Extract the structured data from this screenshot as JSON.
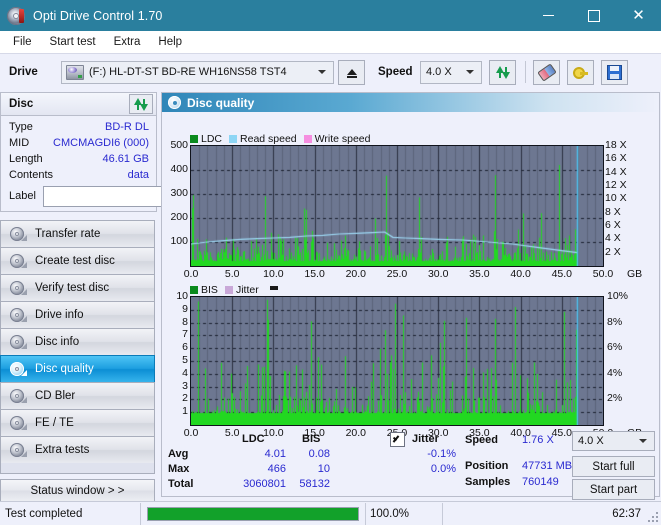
{
  "window": {
    "title": "Opti Drive Control 1.70",
    "app_icon": "disc-icon",
    "minimize": "–",
    "maximize": "□",
    "close": "✕"
  },
  "menu": [
    "File",
    "Start test",
    "Extra",
    "Help"
  ],
  "toolbar": {
    "drive_label": "Drive",
    "drive_value": "(F:)   HL-DT-ST BD-RE  WH16NS58 TST4",
    "eject_label": "eject-button",
    "speed_label": "Speed",
    "speed_value": "4.0 X",
    "refresh_label": "refresh-drive-button",
    "eraser_label": "erase-disc-button",
    "key_label": "drive-key-button",
    "save_label": "save-button"
  },
  "disc_panel": {
    "title": "Disc",
    "refresh_label": "refresh-disc-button",
    "rows": [
      {
        "key": "Type",
        "value": "BD-R DL"
      },
      {
        "key": "MID",
        "value": "CMCMAGDI6 (000)"
      },
      {
        "key": "Length",
        "value": "46.61 GB"
      },
      {
        "key": "Contents",
        "value": "data"
      }
    ],
    "label_key": "Label",
    "label_value": "",
    "label_placeholder": ""
  },
  "nav": {
    "items": [
      {
        "label": "Transfer rate",
        "selected": false
      },
      {
        "label": "Create test disc",
        "selected": false
      },
      {
        "label": "Verify test disc",
        "selected": false
      },
      {
        "label": "Drive info",
        "selected": false
      },
      {
        "label": "Disc info",
        "selected": false
      },
      {
        "label": "Disc quality",
        "selected": true
      },
      {
        "label": "CD Bler",
        "selected": false
      },
      {
        "label": "FE / TE",
        "selected": false
      },
      {
        "label": "Extra tests",
        "selected": false
      }
    ],
    "status_window": "Status window > >"
  },
  "panel": {
    "title": "Disc quality"
  },
  "chart_data": [
    {
      "type": "line",
      "id": "ldc-chart",
      "title": "",
      "legend": [
        {
          "label": "LDC",
          "color": "#0b8a1e"
        },
        {
          "label": "Read speed",
          "color": "#8ed6f5"
        },
        {
          "label": "Write speed",
          "color": "#f58ee0"
        }
      ],
      "legend_position": "top-left",
      "grid": true,
      "xlabel": "GB",
      "ylabel": "",
      "xlim": [
        0,
        50
      ],
      "ylim": [
        0,
        500
      ],
      "xticks": [
        "0.0",
        "5.0",
        "10.0",
        "15.0",
        "20.0",
        "25.0",
        "30.0",
        "35.0",
        "40.0",
        "45.0",
        "50.0"
      ],
      "yticks": [
        "100",
        "200",
        "300",
        "400",
        "500"
      ],
      "y2lim": [
        0,
        18
      ],
      "y2ticks": [
        "2 X",
        "4 X",
        "6 X",
        "8 X",
        "10 X",
        "12 X",
        "14 X",
        "16 X",
        "18 X"
      ],
      "x_unit_label": "GB",
      "data_end_gb": 46.9,
      "read_speed_series": [
        {
          "x": 0.0,
          "y": 3.3
        },
        {
          "x": 2.0,
          "y": 3.6
        },
        {
          "x": 4.0,
          "y": 3.8
        },
        {
          "x": 6.0,
          "y": 4.0
        },
        {
          "x": 8.0,
          "y": 4.1
        },
        {
          "x": 10.0,
          "y": 4.2
        },
        {
          "x": 12.0,
          "y": 4.3
        },
        {
          "x": 14.0,
          "y": 4.5
        },
        {
          "x": 16.0,
          "y": 4.6
        },
        {
          "x": 18.0,
          "y": 4.8
        },
        {
          "x": 20.0,
          "y": 4.9
        },
        {
          "x": 22.0,
          "y": 5.0
        },
        {
          "x": 23.5,
          "y": 5.1
        },
        {
          "x": 24.5,
          "y": 4.3
        },
        {
          "x": 26.0,
          "y": 4.2
        },
        {
          "x": 28.0,
          "y": 4.1
        },
        {
          "x": 30.0,
          "y": 4.0
        },
        {
          "x": 33.0,
          "y": 3.9
        },
        {
          "x": 36.0,
          "y": 3.6
        },
        {
          "x": 39.0,
          "y": 3.3
        },
        {
          "x": 42.0,
          "y": 2.8
        },
        {
          "x": 45.0,
          "y": 2.3
        },
        {
          "x": 46.9,
          "y": 2.0
        }
      ],
      "cursor_x": 46.9,
      "ldc_note": "dense green vertical error bars across 0-47 GB, baseline ~20, peaks up to 466"
    },
    {
      "type": "line",
      "id": "bis-chart",
      "title": "",
      "legend": [
        {
          "label": "BIS",
          "color": "#0b8a1e"
        },
        {
          "label": "Jitter",
          "color": "#c9a8d8"
        }
      ],
      "legend_position": "top-left",
      "grid": true,
      "xlabel": "GB",
      "ylabel": "",
      "xlim": [
        0,
        50
      ],
      "ylim": [
        0,
        10
      ],
      "xticks": [
        "0.0",
        "5.0",
        "10.0",
        "15.0",
        "20.0",
        "25.0",
        "30.0",
        "35.0",
        "40.0",
        "45.0",
        "50.0"
      ],
      "yticks": [
        "1",
        "2",
        "3",
        "4",
        "5",
        "6",
        "7",
        "8",
        "9",
        "10"
      ],
      "y2lim": [
        0,
        10
      ],
      "y2ticks": [
        "2%",
        "4%",
        "6%",
        "8%",
        "10%"
      ],
      "x_unit_label": "GB",
      "data_end_gb": 46.9,
      "cursor_x": 46.9,
      "bis_note": "dense green vertical bars across 0-47 GB, baseline ~1, peaks up to 10"
    }
  ],
  "stats": {
    "col_ldc": "LDC",
    "col_bis": "BIS",
    "jitter_label": "Jitter",
    "jitter_checked": true,
    "rows": [
      {
        "label": "Avg",
        "ldc": "4.01",
        "bis": "0.08",
        "jitter": "-0.1%"
      },
      {
        "label": "Max",
        "ldc": "466",
        "bis": "10",
        "jitter": "0.0%"
      },
      {
        "label": "Total",
        "ldc": "3060801",
        "bis": "58132",
        "jitter": ""
      }
    ],
    "speed_label": "Speed",
    "speed_value": "1.76 X",
    "position_label": "Position",
    "position_value": "47731 MB",
    "samples_label": "Samples",
    "samples_value": "760149",
    "speed_select": "4.0 X",
    "start_full": "Start full",
    "start_part": "Start part"
  },
  "statusbar": {
    "message": "Test completed",
    "progress_pct": 100.0,
    "progress_text": "100.0%",
    "elapsed": "62:37"
  }
}
